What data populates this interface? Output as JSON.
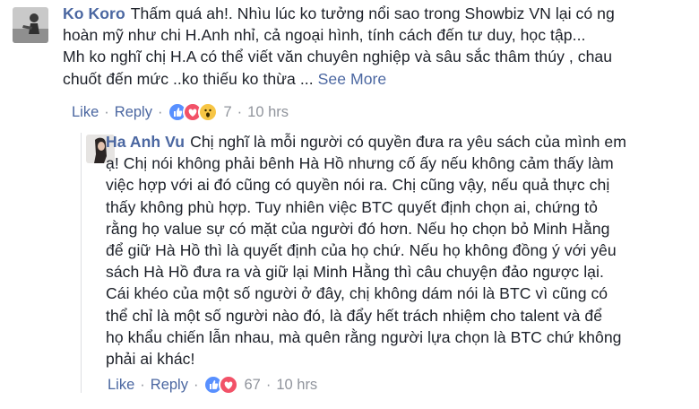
{
  "comments": [
    {
      "author": "Ko Koro",
      "lines": [
        "Thấm quá ah!. Nhìu lúc ko tưởng nổi sao trong Showbiz VN lại có ng",
        "hoàn mỹ như chi H.Anh nhỉ, cả ngoại hình, tính cách đến tư duy, học tập...",
        "Mh ko nghĩ chị H.A có thể viết văn chuyên nghiệp và sâu sắc thâm thúy , chau",
        "chuốt đến mức ..ko thiếu ko thừa ..."
      ],
      "see_more": "See More",
      "actions": {
        "like": "Like",
        "reply": "Reply",
        "reaction_count": "7",
        "time": "10 hrs",
        "reactions": [
          "like-icon",
          "love-icon",
          "wow-icon"
        ]
      }
    },
    {
      "author": "Ha Anh Vu",
      "lines": [
        "Chị nghĩ là mỗi người có quyền đưa ra yêu sách của mình em",
        "ạ! Chị nói không phải bênh Hà Hồ nhưng cố ấy nếu không cảm thấy làm",
        "việc hợp với ai đó cũng có quyền nói ra. Chị cũng vậy, nếu quả thực chị",
        "thấy không phù hợp. Tuy nhiên việc BTC quyết định chọn ai, chứng tỏ",
        "rằng họ value sự có mặt của người đó hơn. Nếu họ chọn bỏ Minh Hằng",
        "để giữ Hà Hồ thì là quyết định của họ chứ. Nếu họ không đồng ý với yêu",
        "sách Hà Hồ đưa ra và giữ lại Minh Hằng thì câu chuyện đảo ngược lại.",
        "Cái khéo của một số người ở đây, chị không dám nói là BTC vì cũng có",
        "thể chỉ là một số người nào đó, là đẩy hết trách nhiệm cho talent và để",
        "họ khẩu chiến lẫn nhau, mà quên rằng người lựa chọn là BTC chứ không",
        "phải ai khác!"
      ],
      "actions": {
        "like": "Like",
        "reply": "Reply",
        "reaction_count": "67",
        "time": "10 hrs",
        "reactions": [
          "like-icon",
          "love-icon"
        ]
      }
    }
  ],
  "colors": {
    "link": "#4b67a1",
    "meta": "#90949c",
    "text": "#1d2129",
    "like": "#5890ff",
    "love": "#f25268",
    "wow": "#f7c544"
  }
}
